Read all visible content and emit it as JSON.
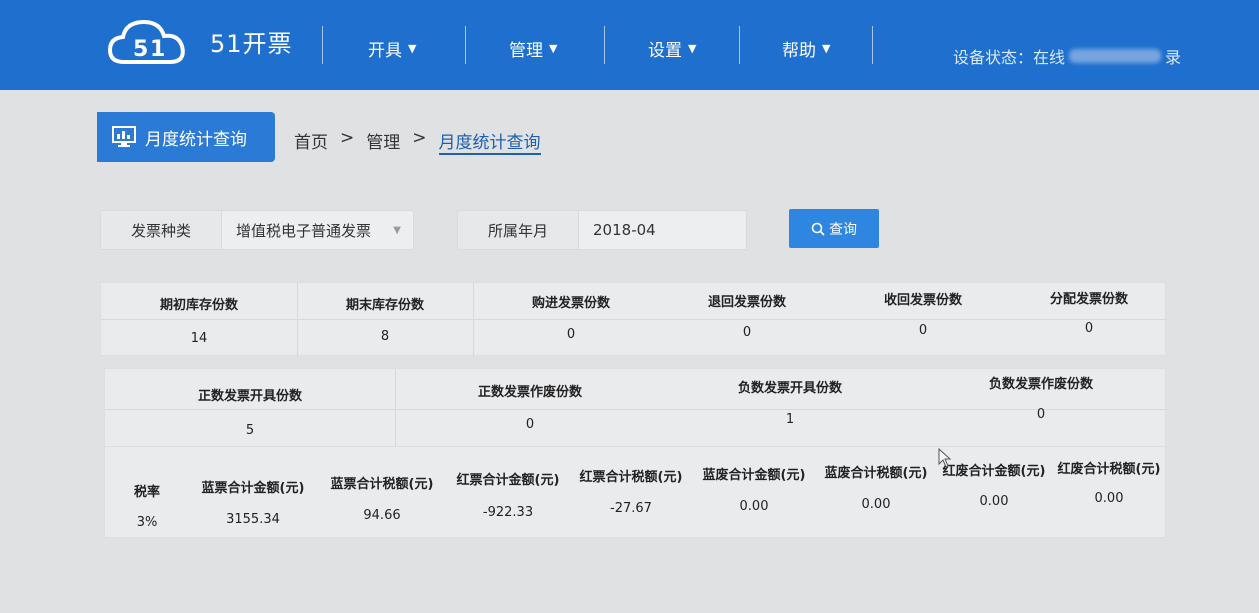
{
  "app": {
    "logo_text": "51开票"
  },
  "nav": {
    "items": [
      {
        "label": "开具"
      },
      {
        "label": "管理"
      },
      {
        "label": "设置"
      },
      {
        "label": "帮助"
      }
    ],
    "device_status_label": "设备状态：在线",
    "device_status_suffix": "录"
  },
  "page": {
    "title": "月度统计查询",
    "breadcrumb": [
      "首页",
      ">",
      "管理",
      ">",
      "月度统计查询"
    ]
  },
  "filters": {
    "invoice_type_label": "发票种类",
    "invoice_type_value": "增值税电子普通发票",
    "period_label": "所属年月",
    "period_value": "2018-04",
    "query_button": "查询"
  },
  "table1": {
    "headers": [
      "期初库存份数",
      "期末库存份数",
      "购进发票份数",
      "退回发票份数",
      "收回发票份数",
      "分配发票份数"
    ],
    "values": [
      "14",
      "8",
      "0",
      "0",
      "0",
      "0"
    ]
  },
  "table2": {
    "headers": [
      "正数发票开具份数",
      "正数发票作废份数",
      "负数发票开具份数",
      "负数发票作废份数"
    ],
    "values": [
      "5",
      "0",
      "1",
      "0"
    ]
  },
  "table3": {
    "headers": [
      "税率",
      "蓝票合计金额(元)",
      "蓝票合计税额(元)",
      "红票合计金额(元)",
      "红票合计税额(元)",
      "蓝废合计金额(元)",
      "蓝废合计税额(元)",
      "红废合计金额(元)",
      "红废合计税额(元)"
    ],
    "values": [
      "3%",
      "3155.34",
      "94.66",
      "-922.33",
      "-27.67",
      "0.00",
      "0.00",
      "0.00",
      "0.00"
    ]
  },
  "colors": {
    "topbar": "#1f6fce",
    "page_tab": "#2a7ad6",
    "query_button": "#2e86e0"
  }
}
